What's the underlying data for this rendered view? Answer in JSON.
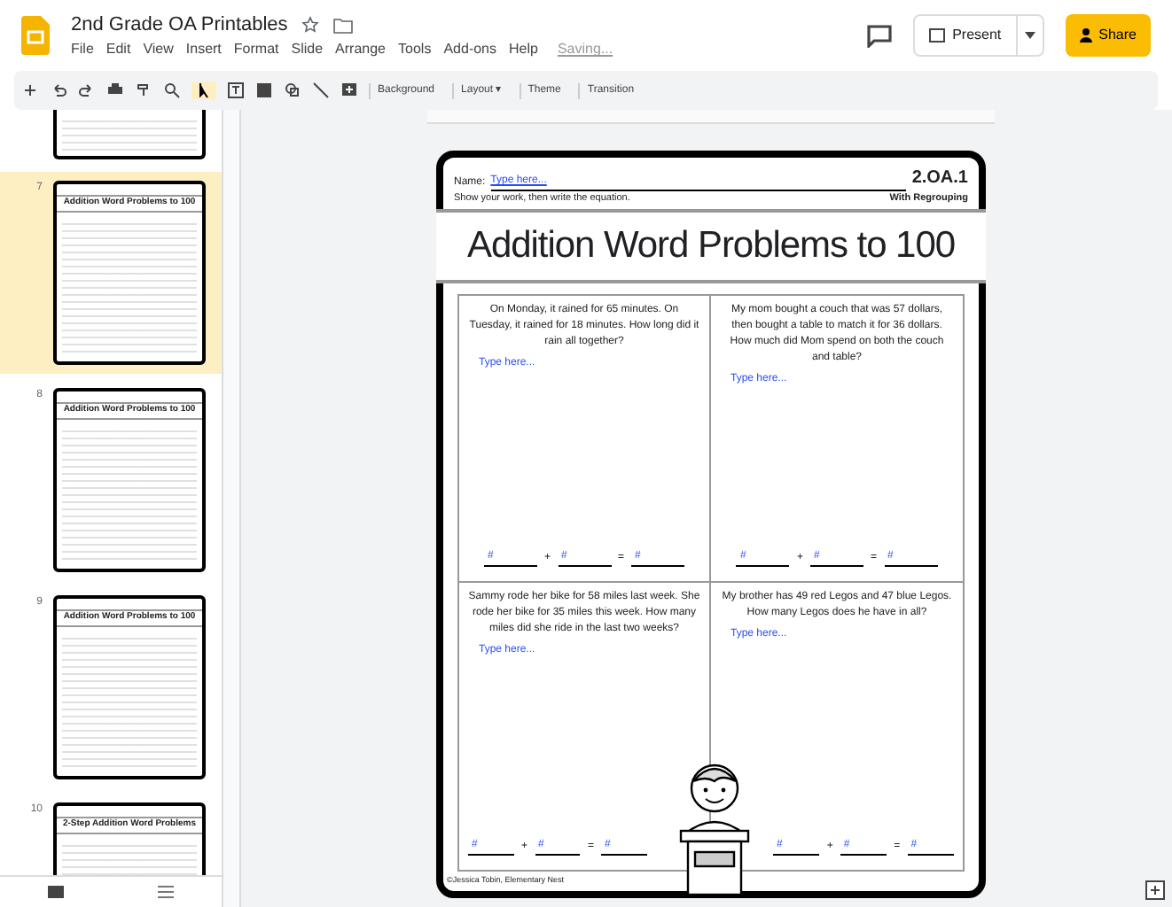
{
  "app": {
    "title": "2nd Grade OA Printables",
    "menu": [
      "File",
      "Edit",
      "View",
      "Insert",
      "Format",
      "Slide",
      "Arrange",
      "Tools",
      "Add-ons",
      "Help"
    ],
    "save_status": "Saving...",
    "present": "Present",
    "share": "Share"
  },
  "toolbar": {
    "buttons": [
      "Background",
      "Layout ▾",
      "Theme",
      "Transition"
    ]
  },
  "filmstrip": [
    {
      "selected": false
    },
    {
      "number": "7",
      "title": "Addition Word Problems to 100",
      "selected": true
    },
    {
      "number": "8",
      "title": "Addition Word Problems to 100",
      "selected": false
    },
    {
      "number": "9",
      "title": "Addition Word Problems to 100",
      "selected": false
    },
    {
      "number": "10",
      "title": "2-Step Addition Word Problems",
      "selected": false
    }
  ],
  "slide": {
    "name_label": "Name:",
    "name_placeholder": "Type here...",
    "standard": "2.OA.1",
    "instructions": "Show your work, then write the equation.",
    "subtitle": "With Regrouping",
    "title": "Addition Word Problems to 100",
    "problems": [
      {
        "question": "On Monday, it rained for 65 minutes. On Tuesday, it rained for 18 minutes. How long did it rain all together?",
        "placeholder": "Type here...",
        "blanks": [
          "#",
          "#",
          "#"
        ],
        "plus": "+",
        "equals": "="
      },
      {
        "question": "My mom bought a couch that was 57 dollars, then bought a table to match it for 36 dollars. How much did Mom spend on both the couch and table?",
        "placeholder": "Type here...",
        "blanks": [
          "#",
          "#",
          "#"
        ],
        "plus": "+",
        "equals": "="
      },
      {
        "question": "Sammy rode her bike for 58 miles last week. She rode her bike for 35 miles this week. How many miles did she ride in the last two weeks?",
        "placeholder": "Type here...",
        "blanks": [
          "#",
          "#",
          "#"
        ],
        "plus": "+",
        "equals": "="
      },
      {
        "question": "My brother has 49 red Legos and 47 blue Legos. How many Legos does he have in all?",
        "placeholder": "Type here...",
        "blanks": [
          "#",
          "#",
          "#"
        ],
        "plus": "+",
        "equals": "="
      }
    ],
    "footer": "©Jessica Tobin, Elementary Nest"
  }
}
